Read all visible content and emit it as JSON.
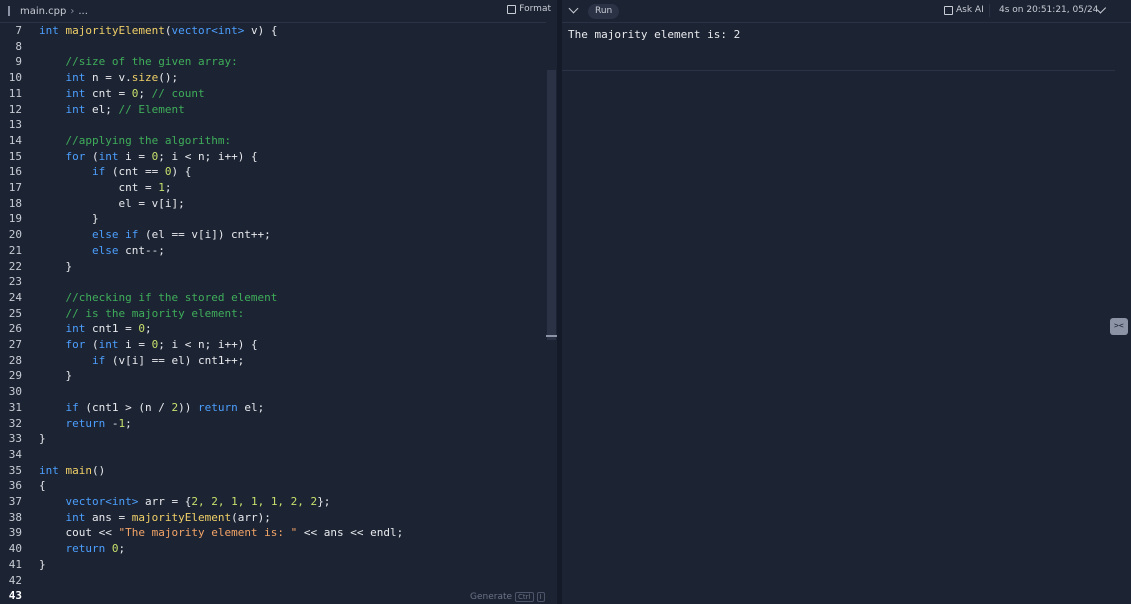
{
  "editor": {
    "breadcrumb": {
      "file": "main.cpp",
      "sep": "›",
      "more": "..."
    },
    "format_label": "Format",
    "generate_label": "Generate",
    "generate_shortcut": "Ctrl",
    "generate_shortcut_key": "I",
    "current_line": "43",
    "lines": [
      {
        "n": "7"
      },
      {
        "n": "8"
      },
      {
        "n": "9"
      },
      {
        "n": "10"
      },
      {
        "n": "11"
      },
      {
        "n": "12"
      },
      {
        "n": "13"
      },
      {
        "n": "14"
      },
      {
        "n": "15"
      },
      {
        "n": "16"
      },
      {
        "n": "17"
      },
      {
        "n": "18"
      },
      {
        "n": "19"
      },
      {
        "n": "20"
      },
      {
        "n": "21"
      },
      {
        "n": "22"
      },
      {
        "n": "23"
      },
      {
        "n": "24"
      },
      {
        "n": "25"
      },
      {
        "n": "26"
      },
      {
        "n": "27"
      },
      {
        "n": "28"
      },
      {
        "n": "29"
      },
      {
        "n": "30"
      },
      {
        "n": "31"
      },
      {
        "n": "32"
      },
      {
        "n": "33"
      },
      {
        "n": "34"
      },
      {
        "n": "35"
      },
      {
        "n": "36"
      },
      {
        "n": "37"
      },
      {
        "n": "38"
      },
      {
        "n": "39"
      },
      {
        "n": "40"
      },
      {
        "n": "41"
      },
      {
        "n": "42"
      },
      {
        "n": "43"
      }
    ],
    "code": {
      "l7a": "int ",
      "l7b": "majorityElement",
      "l7c": "(",
      "l7d": "vector<int>",
      "l7e": " v) {",
      "l9": "//size of the given array:",
      "l10a": "int",
      " l10b": " n = v.",
      "l10c": "size",
      "l10d": "();",
      "l11a": "int",
      "l11b": " cnt = ",
      "l11c": "0",
      "l11d": "; ",
      "l11e": "// count",
      "l12a": "int",
      "l12b": " el; ",
      "l12c": "// Element",
      "l14": "//applying the algorithm:",
      "l15a": "for",
      " l15b": " (",
      "l15c": "int",
      "l15d": " i = ",
      "l15e": "0",
      "l15f": "; i < n; i++) {",
      "l16a": "if",
      "l16b": " (cnt == ",
      "l16c": "0",
      "l16d": ") {",
      "l17a": "cnt = ",
      "l17b": "1",
      "l17c": ";",
      "l18": "el = v[i];",
      "l19": "}",
      "l20a": "else if",
      "l20b": " (el == v[i]) cnt++;",
      "l21a": "else",
      "l21b": " cnt--;",
      "l22": "}",
      "l24": "//checking if the stored element",
      "l25": "// is the majority element:",
      "l26a": "int",
      "l26b": " cnt1 = ",
      "l26c": "0",
      "l26d": ";",
      "l27a": "for",
      "l27b": " (",
      "l27c": "int",
      "l27d": " i = ",
      "l27e": "0",
      "l27f": "; i < n; i++) {",
      "l28a": "if",
      "l28b": " (v[i] == el) cnt1++;",
      "l29": "}",
      "l31a": "if",
      "l31b": " (cnt1 > (n / ",
      "l31c": "2",
      "l31d": ")) ",
      "l31e": "return",
      "l31f": " el;",
      "l32a": "return",
      "l32b": " -",
      "l32c": "1",
      "l32d": ";",
      "l33": "}",
      "l35a": "int ",
      "l35b": "main",
      "l35c": "()",
      "l36": "{",
      "l37a": "vector<int>",
      "l37b": " arr = {",
      "l37c": "2, 2, 1, 1, 1, 2, 2",
      "l37d": "};",
      "l38a": "int",
      "l38b": " ans = ",
      "l38c": "majorityElement",
      "l38d": "(arr);",
      "l39a": "cout << ",
      "l39b": "\"The majority element is: \"",
      "l39c": " << ans << endl;",
      "l40a": "return ",
      "l40b": "0",
      "l40c": ";",
      "l41": "}"
    }
  },
  "console": {
    "run_label": "Run",
    "ask_ai_label": "Ask AI",
    "runtime": "4s on 20:51:21, 05/24",
    "output": "The majority element is: 2"
  },
  "icons": {
    "format": "format-icon",
    "chevron": "chevron-down-icon",
    "ai": "ask-ai-icon",
    "check": "check-icon"
  }
}
